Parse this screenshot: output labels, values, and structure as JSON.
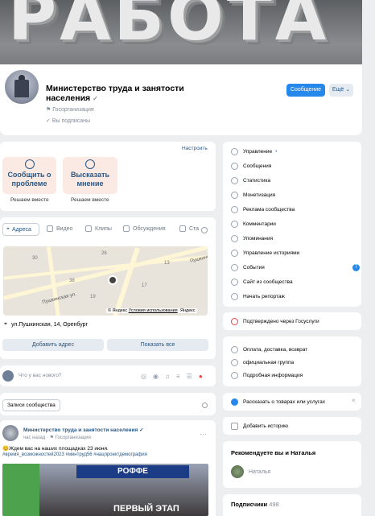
{
  "cover": {
    "text": "РАБОТА"
  },
  "group": {
    "name": "Министерство труда и занятости населения",
    "type": "Госорганизация",
    "subscribed": "Вы подписаны",
    "message_btn": "Сообщение",
    "more_btn": "Ещё"
  },
  "widget": {
    "settings": "Настроить",
    "cards": [
      {
        "label": "Сообщить о проблеме",
        "sub": "Решаем вместе"
      },
      {
        "label": "Высказать мнение",
        "sub": "Решаем вместе"
      }
    ]
  },
  "tabs": [
    "Адреса",
    "Видео",
    "Клипы",
    "Обсуждения",
    "Ста"
  ],
  "map": {
    "street_label": "Пушкинская ул.",
    "street_label2": "Пушкинская",
    "copyright": "© Яндекс",
    "terms": "Условия использования",
    "yandex": "Яндекс",
    "numbers": [
      "30",
      "13",
      "19",
      "17",
      "26",
      "38"
    ]
  },
  "address": {
    "text": "ул.Пушкинская, 14, Оренбург",
    "add_btn": "Добавить адрес",
    "show_all_btn": "Показать все"
  },
  "composer": {
    "placeholder": "Что у вас нового?"
  },
  "wall": {
    "tab": "Записи сообщества"
  },
  "post": {
    "author": "Министерство труда и занятости населения",
    "time": "час назад",
    "type": "Госорганизация",
    "text": "😊Ждем вас на наших площадках 23 июня.",
    "hashtags": "#время_возможностей2023 #минтруд56 #нацпроектдемография",
    "img_texts": [
      "РОФФЕ",
      "ПЕРВЫЙ ЭТАП"
    ]
  },
  "menu": {
    "items": [
      "Управление",
      "Сообщения",
      "Статистика",
      "Монетизация",
      "Реклама сообщества",
      "Комментарии",
      "Упоминания",
      "Управление историями",
      "События",
      "Сайт из сообщества",
      "Начать репортаж"
    ],
    "events_badge": "7"
  },
  "gosuslugi": {
    "text": "Подтверждено через Госуслуги"
  },
  "info": {
    "items": [
      "Оплата, доставка, возврат",
      "официальная группа",
      "Подробная информация"
    ]
  },
  "promo": {
    "text": "Рассказать о товарах или услугах"
  },
  "story": {
    "text": "Добавить историю"
  },
  "recommend": {
    "title": "Рекомендуете вы и Наталья",
    "person": "Наталья"
  },
  "subscribers": {
    "label": "Подписчики",
    "count": "498"
  },
  "colors": {
    "accent": "#2688eb",
    "link": "#2a5885",
    "bg": "#edeef0"
  }
}
